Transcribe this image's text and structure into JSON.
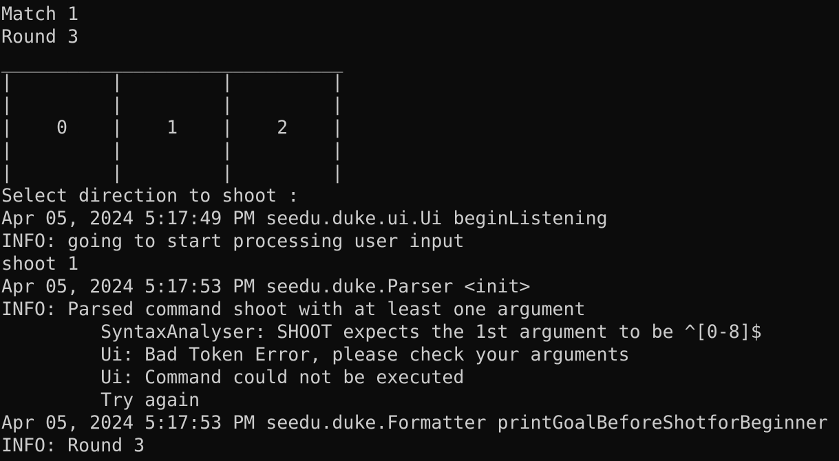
{
  "terminal": {
    "background": "#0c0c0c",
    "foreground": "#cccccc",
    "lines": [
      "Match 1",
      "Round 3",
      "",
      "_______________________________",
      "|         |         |         |",
      "|         |         |         |",
      "|    0    |    1    |    2    |",
      "|         |         |         |",
      "|         |         |         |",
      "Select direction to shoot :",
      "Apr 05, 2024 5:17:49 PM seedu.duke.ui.Ui beginListening",
      "INFO: going to start processing user input",
      "shoot 1",
      "Apr 05, 2024 5:17:53 PM seedu.duke.Parser <init>",
      "INFO: Parsed command shoot with at least one argument",
      "         SyntaxAnalyser: SHOOT expects the 1st argument to be ^[0-8]$",
      "         Ui: Bad Token Error, please check your arguments",
      "         Ui: Command could not be executed",
      "         Try again",
      "Apr 05, 2024 5:17:53 PM seedu.duke.Formatter printGoalBeforeShotforBeginner",
      "INFO: Round 3"
    ],
    "partial_line": "----"
  }
}
